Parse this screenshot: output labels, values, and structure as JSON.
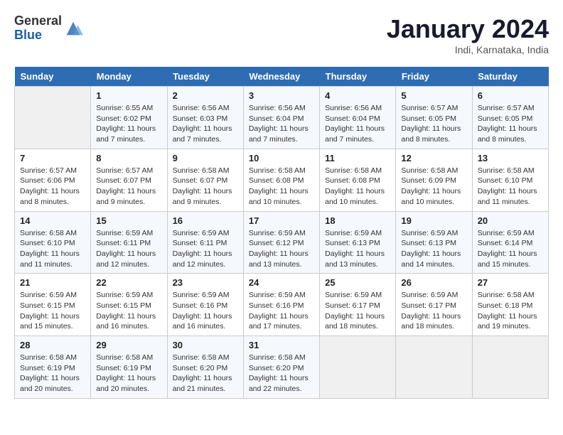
{
  "logo": {
    "general": "General",
    "blue": "Blue"
  },
  "title": "January 2024",
  "subtitle": "Indi, Karnataka, India",
  "days_of_week": [
    "Sunday",
    "Monday",
    "Tuesday",
    "Wednesday",
    "Thursday",
    "Friday",
    "Saturday"
  ],
  "weeks": [
    [
      {
        "num": "",
        "info": ""
      },
      {
        "num": "1",
        "info": "Sunrise: 6:55 AM\nSunset: 6:02 PM\nDaylight: 11 hours and 7 minutes."
      },
      {
        "num": "2",
        "info": "Sunrise: 6:56 AM\nSunset: 6:03 PM\nDaylight: 11 hours and 7 minutes."
      },
      {
        "num": "3",
        "info": "Sunrise: 6:56 AM\nSunset: 6:04 PM\nDaylight: 11 hours and 7 minutes."
      },
      {
        "num": "4",
        "info": "Sunrise: 6:56 AM\nSunset: 6:04 PM\nDaylight: 11 hours and 7 minutes."
      },
      {
        "num": "5",
        "info": "Sunrise: 6:57 AM\nSunset: 6:05 PM\nDaylight: 11 hours and 8 minutes."
      },
      {
        "num": "6",
        "info": "Sunrise: 6:57 AM\nSunset: 6:05 PM\nDaylight: 11 hours and 8 minutes."
      }
    ],
    [
      {
        "num": "7",
        "info": "Sunrise: 6:57 AM\nSunset: 6:06 PM\nDaylight: 11 hours and 8 minutes."
      },
      {
        "num": "8",
        "info": "Sunrise: 6:57 AM\nSunset: 6:07 PM\nDaylight: 11 hours and 9 minutes."
      },
      {
        "num": "9",
        "info": "Sunrise: 6:58 AM\nSunset: 6:07 PM\nDaylight: 11 hours and 9 minutes."
      },
      {
        "num": "10",
        "info": "Sunrise: 6:58 AM\nSunset: 6:08 PM\nDaylight: 11 hours and 10 minutes."
      },
      {
        "num": "11",
        "info": "Sunrise: 6:58 AM\nSunset: 6:08 PM\nDaylight: 11 hours and 10 minutes."
      },
      {
        "num": "12",
        "info": "Sunrise: 6:58 AM\nSunset: 6:09 PM\nDaylight: 11 hours and 10 minutes."
      },
      {
        "num": "13",
        "info": "Sunrise: 6:58 AM\nSunset: 6:10 PM\nDaylight: 11 hours and 11 minutes."
      }
    ],
    [
      {
        "num": "14",
        "info": "Sunrise: 6:58 AM\nSunset: 6:10 PM\nDaylight: 11 hours and 11 minutes."
      },
      {
        "num": "15",
        "info": "Sunrise: 6:59 AM\nSunset: 6:11 PM\nDaylight: 11 hours and 12 minutes."
      },
      {
        "num": "16",
        "info": "Sunrise: 6:59 AM\nSunset: 6:11 PM\nDaylight: 11 hours and 12 minutes."
      },
      {
        "num": "17",
        "info": "Sunrise: 6:59 AM\nSunset: 6:12 PM\nDaylight: 11 hours and 13 minutes."
      },
      {
        "num": "18",
        "info": "Sunrise: 6:59 AM\nSunset: 6:13 PM\nDaylight: 11 hours and 13 minutes."
      },
      {
        "num": "19",
        "info": "Sunrise: 6:59 AM\nSunset: 6:13 PM\nDaylight: 11 hours and 14 minutes."
      },
      {
        "num": "20",
        "info": "Sunrise: 6:59 AM\nSunset: 6:14 PM\nDaylight: 11 hours and 15 minutes."
      }
    ],
    [
      {
        "num": "21",
        "info": "Sunrise: 6:59 AM\nSunset: 6:15 PM\nDaylight: 11 hours and 15 minutes."
      },
      {
        "num": "22",
        "info": "Sunrise: 6:59 AM\nSunset: 6:15 PM\nDaylight: 11 hours and 16 minutes."
      },
      {
        "num": "23",
        "info": "Sunrise: 6:59 AM\nSunset: 6:16 PM\nDaylight: 11 hours and 16 minutes."
      },
      {
        "num": "24",
        "info": "Sunrise: 6:59 AM\nSunset: 6:16 PM\nDaylight: 11 hours and 17 minutes."
      },
      {
        "num": "25",
        "info": "Sunrise: 6:59 AM\nSunset: 6:17 PM\nDaylight: 11 hours and 18 minutes."
      },
      {
        "num": "26",
        "info": "Sunrise: 6:59 AM\nSunset: 6:17 PM\nDaylight: 11 hours and 18 minutes."
      },
      {
        "num": "27",
        "info": "Sunrise: 6:58 AM\nSunset: 6:18 PM\nDaylight: 11 hours and 19 minutes."
      }
    ],
    [
      {
        "num": "28",
        "info": "Sunrise: 6:58 AM\nSunset: 6:19 PM\nDaylight: 11 hours and 20 minutes."
      },
      {
        "num": "29",
        "info": "Sunrise: 6:58 AM\nSunset: 6:19 PM\nDaylight: 11 hours and 20 minutes."
      },
      {
        "num": "30",
        "info": "Sunrise: 6:58 AM\nSunset: 6:20 PM\nDaylight: 11 hours and 21 minutes."
      },
      {
        "num": "31",
        "info": "Sunrise: 6:58 AM\nSunset: 6:20 PM\nDaylight: 11 hours and 22 minutes."
      },
      {
        "num": "",
        "info": ""
      },
      {
        "num": "",
        "info": ""
      },
      {
        "num": "",
        "info": ""
      }
    ]
  ]
}
